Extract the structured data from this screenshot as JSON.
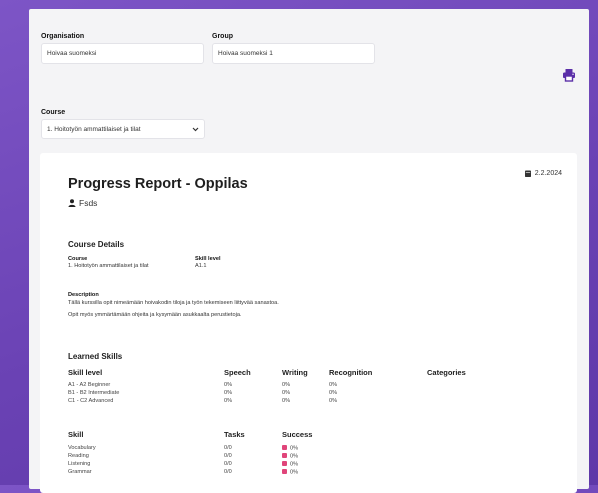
{
  "filters": {
    "organisation": {
      "label": "Organisation",
      "value": "Hoivaa suomeksi"
    },
    "group": {
      "label": "Group",
      "value": "Hoivaa suomeksi 1"
    },
    "course": {
      "label": "Course",
      "value": "1. Hoitotyön ammattilaiset ja tilat"
    }
  },
  "report": {
    "title": "Progress Report - Oppilas",
    "date": "2.2.2024",
    "user": "Fsds",
    "course_details": {
      "heading": "Course Details",
      "course_label": "Course",
      "course_value": "1. Hoitotyön ammattilaiset ja tilat",
      "skill_level_label": "Skill level",
      "skill_level_value": "A1.1",
      "description_label": "Description",
      "description_lines": [
        "Tällä kurssilla opit nimeämään hoivakodin tiloja ja työn tekemiseen liittyvää sanastoa.",
        "Opit myös ymmärtämään ohjeita ja kysymään asukkaalta perustietoja."
      ]
    },
    "learned_skills": {
      "heading": "Learned Skills",
      "levels_table": {
        "headers": [
          "Skill level",
          "Speech",
          "Writing",
          "Recognition",
          "Categories"
        ],
        "rows": [
          [
            "A1 - A2 Beginner",
            "0%",
            "0%",
            "0%"
          ],
          [
            "B1 - B2 Intermediate",
            "0%",
            "0%",
            "0%"
          ],
          [
            "C1 - C2 Advanced",
            "0%",
            "0%",
            "0%"
          ]
        ]
      },
      "skills_table": {
        "headers": [
          "Skill",
          "Tasks",
          "Success"
        ],
        "rows": [
          [
            "Vocabulary",
            "0/0",
            "0%"
          ],
          [
            "Reading",
            "0/0",
            "0%"
          ],
          [
            "Listening",
            "0/0",
            "0%"
          ],
          [
            "Grammar",
            "0/0",
            "0%"
          ]
        ]
      }
    }
  },
  "colors": {
    "background": "#6a42b4",
    "print_icon": "#5b2fa8",
    "success_marker": "#e0457a"
  },
  "icons": {
    "print": "printer-icon",
    "date": "calendar-icon",
    "user": "user-icon",
    "chevron": "chevron-down-icon"
  }
}
